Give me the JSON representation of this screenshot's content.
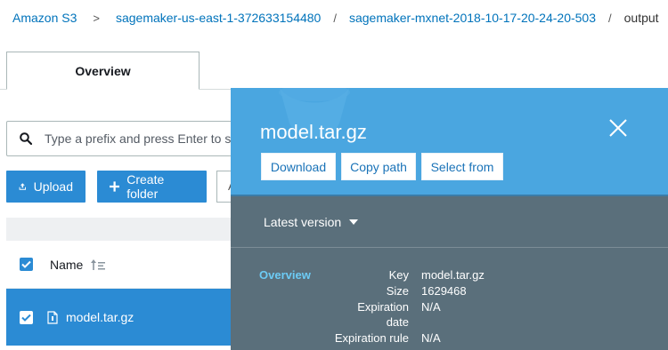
{
  "breadcrumb": {
    "root": "Amazon S3",
    "bucket": "sagemaker-us-east-1-372633154480",
    "folder": "sagemaker-mxnet-2018-10-17-20-24-20-503",
    "current": "output",
    "separator_first": ">",
    "separator": "/"
  },
  "tabs": {
    "overview": "Overview"
  },
  "search": {
    "placeholder": "Type a prefix and press Enter to search"
  },
  "actions": {
    "upload": "Upload",
    "create_folder": "Create folder",
    "more": "A"
  },
  "table": {
    "column_name": "Name",
    "rows": [
      {
        "name": "model.tar.gz",
        "selected": true
      }
    ]
  },
  "panel": {
    "title": "model.tar.gz",
    "buttons": {
      "download": "Download",
      "copy_path": "Copy path",
      "select_from": "Select from"
    },
    "version": "Latest version",
    "section": "Overview",
    "fields": {
      "key_label": "Key",
      "key_value": "model.tar.gz",
      "size_label": "Size",
      "size_value": "1629468",
      "expiration_label_1": "Expiration",
      "expiration_label_2": "date",
      "expiration_value": "N/A",
      "expiration_rule_label": "Expiration rule",
      "expiration_rule_value": "N/A"
    }
  },
  "colors": {
    "accent": "#2b8bd4",
    "panel_header": "#4aa6e0",
    "panel_body": "#5a6f7b",
    "link": "#0073bb",
    "overview_label": "#6ccbf5"
  },
  "icons": [
    "search-icon",
    "upload-icon",
    "plus-icon",
    "checkbox-icon",
    "sort-icon",
    "file-icon",
    "close-icon",
    "caret-down-icon"
  ]
}
